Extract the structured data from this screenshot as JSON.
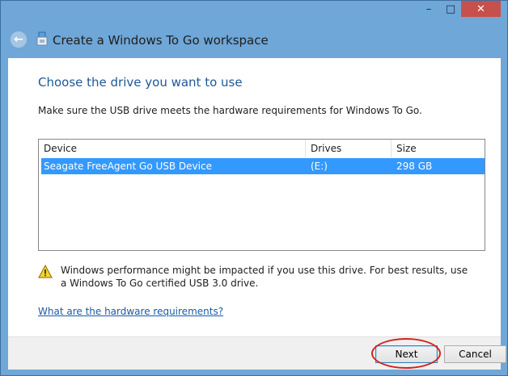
{
  "window": {
    "title": "Create a Windows To Go workspace",
    "controls": {
      "minimize": "–",
      "maximize": "□",
      "close": "✕"
    },
    "back_glyph": "←"
  },
  "page": {
    "heading": "Choose the drive you want to use",
    "instruction": "Make sure the USB drive meets the hardware requirements for Windows To Go."
  },
  "drive_list": {
    "columns": [
      "Device",
      "Drives",
      "Size"
    ],
    "rows": [
      {
        "device": "Seagate FreeAgent Go USB Device",
        "drive": "(E:)",
        "size": "298 GB",
        "selected": true
      }
    ]
  },
  "warning": {
    "icon": "warning-icon",
    "text": "Windows performance might be impacted if you use this drive. For best results, use a Windows To Go certified USB 3.0 drive."
  },
  "help_link": "What are the hardware requirements?",
  "footer": {
    "next_label": "Next",
    "cancel_label": "Cancel"
  },
  "colors": {
    "frame": "#6ea7d8",
    "close_button": "#c7504c",
    "heading": "#1e5797",
    "selection": "#3399ff",
    "link": "#1a5aa8",
    "highlight": "#d0241e"
  }
}
